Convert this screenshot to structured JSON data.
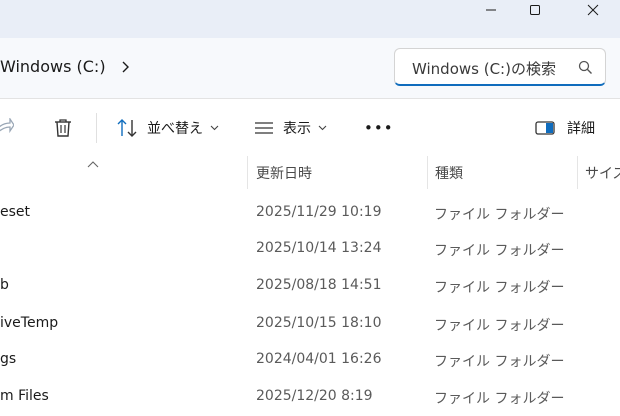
{
  "window": {
    "minimize": "minimize",
    "maximize": "maximize",
    "close": "close"
  },
  "address": {
    "current": "Windows (C:)",
    "search_text": "Windows (C:)の検索"
  },
  "toolbar": {
    "sort_label": "並べ替え",
    "view_label": "表示",
    "more_label": "•••",
    "details_label": "詳細"
  },
  "columns": {
    "date": "更新日時",
    "type": "種類",
    "size": "サイズ"
  },
  "rows": [
    {
      "name": "eset",
      "date": "2025/11/29 10:19",
      "type": "ファイル フォルダー"
    },
    {
      "name": "",
      "date": "2025/10/14 13:24",
      "type": "ファイル フォルダー"
    },
    {
      "name": "b",
      "date": "2025/08/18 14:51",
      "type": "ファイル フォルダー"
    },
    {
      "name": "iveTemp",
      "date": "2025/10/15 18:10",
      "type": "ファイル フォルダー"
    },
    {
      "name": "gs",
      "date": "2024/04/01 16:26",
      "type": "ファイル フォルダー"
    },
    {
      "name": "m Files",
      "date": "2025/12/20 8:19",
      "type": "ファイル フォルダー"
    }
  ]
}
